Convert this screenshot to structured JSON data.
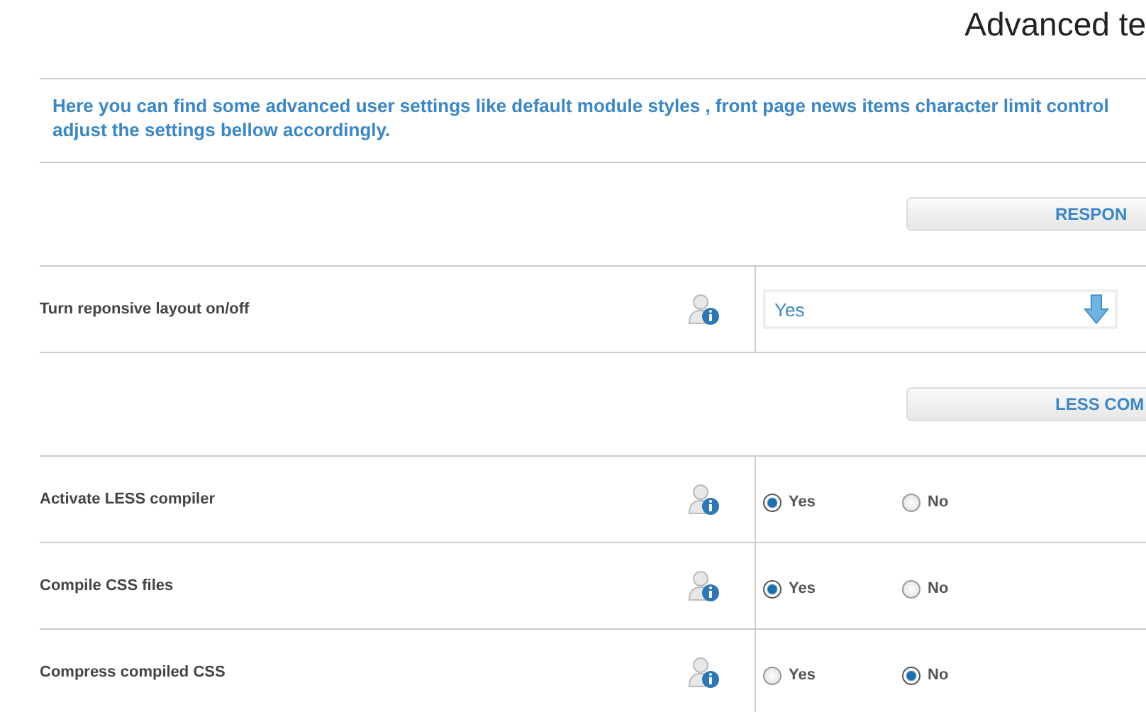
{
  "title": "Advanced te",
  "intro": "Here you can find some advanced user settings like default module styles , front page news items character limit control",
  "intro_line2": "adjust the settings bellow accordingly.",
  "sections": [
    {
      "heading": "RESPON",
      "rows": [
        {
          "kind": "select",
          "label": "Turn reponsive layout on/off",
          "value": "Yes"
        }
      ]
    },
    {
      "heading": "LESS COM",
      "rows": [
        {
          "kind": "radio",
          "label": "Activate LESS compiler",
          "options": [
            {
              "label": "Yes",
              "selected": true
            },
            {
              "label": "No",
              "selected": false
            }
          ]
        },
        {
          "kind": "radio",
          "label": "Compile CSS files",
          "options": [
            {
              "label": "Yes",
              "selected": true
            },
            {
              "label": "No",
              "selected": false
            }
          ]
        },
        {
          "kind": "radio",
          "label": "Compress compiled CSS",
          "options": [
            {
              "label": "Yes",
              "selected": false
            },
            {
              "label": "No",
              "selected": true
            }
          ]
        }
      ]
    }
  ]
}
